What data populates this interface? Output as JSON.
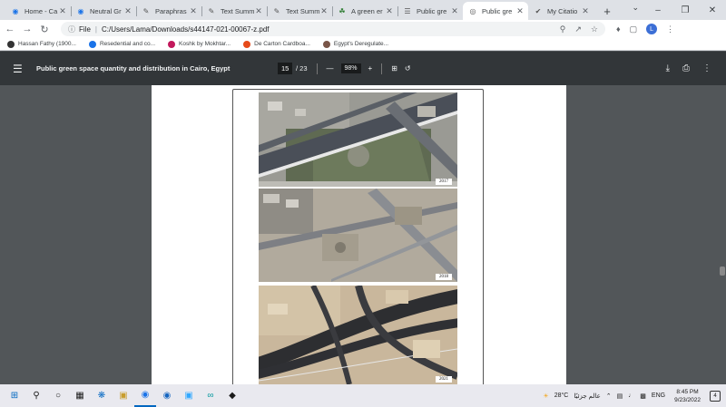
{
  "browser": {
    "tabs": [
      {
        "title": "Home - Ca",
        "icon": "chrome-icon",
        "color": "#1a73e8"
      },
      {
        "title": "Neutral Gr",
        "icon": "chrome-icon",
        "color": "#1a73e8"
      },
      {
        "title": "Paraphras",
        "icon": "quill-icon",
        "color": "#555"
      },
      {
        "title": "Text Summ",
        "icon": "quill-icon",
        "color": "#555"
      },
      {
        "title": "Text Summ",
        "icon": "quill-icon",
        "color": "#555"
      },
      {
        "title": "A green er",
        "icon": "leaf-icon",
        "color": "#2e7d32"
      },
      {
        "title": "Public gre",
        "icon": "doc-icon",
        "color": "#555"
      },
      {
        "title": "Public gre",
        "icon": "globe-icon",
        "color": "#555"
      },
      {
        "title": "My Citatio",
        "icon": "check-icon",
        "color": "#555"
      }
    ],
    "active_tab_index": 7,
    "new_tab": "+",
    "address": {
      "prefix": "File",
      "url": "C:/Users/Lama/Downloads/s44147-021-00067-z.pdf"
    },
    "profile_initial": "L",
    "bookmarks": [
      {
        "label": "Hassan Fathy (1900...",
        "color": "#333"
      },
      {
        "label": "Resedential and co...",
        "color": "#1a73e8"
      },
      {
        "label": "Koshk by Mokhtar...",
        "color": "#c2185b"
      },
      {
        "label": "De Carton Cardboa...",
        "color": "#e64a19"
      },
      {
        "label": "Egypt's Deregulate...",
        "color": "#795548"
      }
    ]
  },
  "pdf": {
    "title": "Public green space quantity and distribution in Cairo, Egypt",
    "page_current": "15",
    "page_total": "/ 23",
    "zoom": "98%",
    "zoom_out": "—",
    "zoom_in": "+"
  },
  "figure": {
    "years": [
      "2017",
      "2018",
      "2021"
    ]
  },
  "taskbar": {
    "weather": "28°C",
    "weather_text": "عالم جزئيًا",
    "language": "ENG",
    "time": "8:45 PM",
    "date": "9/23/2022",
    "notifications": "4"
  }
}
